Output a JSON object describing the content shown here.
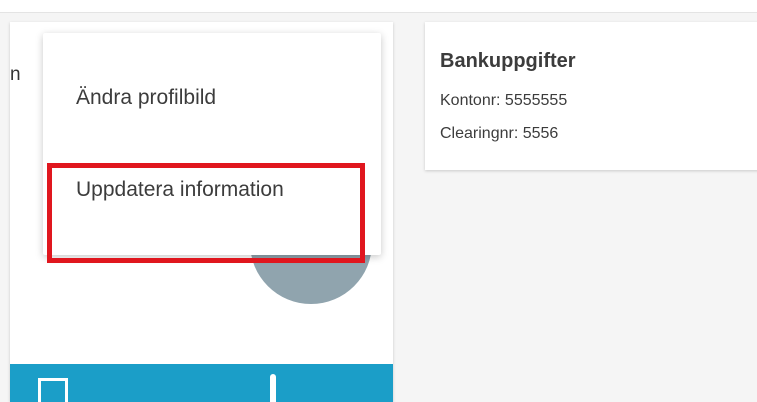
{
  "profile_card": {
    "partial_title": "n"
  },
  "menu": {
    "items": [
      {
        "label": "Ändra profilbild"
      },
      {
        "label": "Uppdatera information"
      }
    ]
  },
  "bank": {
    "title": "Bankuppgifter",
    "account_label": "Kontonr: 5555555",
    "clearing_label": "Clearingnr: 5556"
  },
  "colors": {
    "accent_bar": "#1b9ec8",
    "highlight": "#e0161e",
    "avatar": "#90a4ae"
  }
}
